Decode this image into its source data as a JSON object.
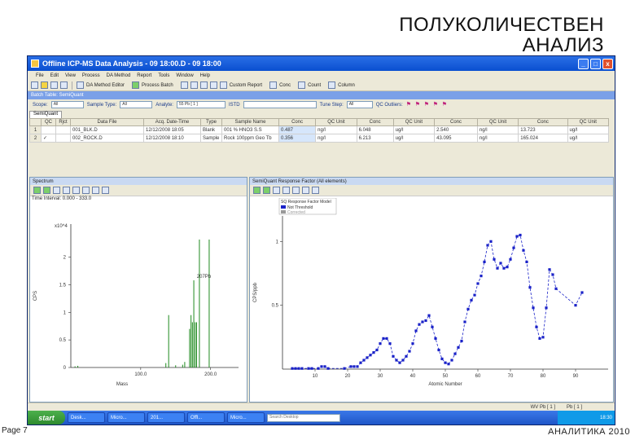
{
  "slide": {
    "title_line1": "ПОЛУКОЛИЧЕСТВЕН",
    "title_line2": "АНАЛИЗ",
    "page": "Page 7",
    "footer": "АНАЛИТИКА 2010"
  },
  "window": {
    "title": "Offline ICP-MS Data Analysis - 09 18:00.D - 09 18:00",
    "buttons": [
      "_",
      "□",
      "x"
    ]
  },
  "menu": [
    "File",
    "Edit",
    "View",
    "Process",
    "DA Method",
    "Report",
    "Tools",
    "Window",
    "Help"
  ],
  "toolbar": {
    "labels": [
      "DA Method Editor",
      "Process Batch",
      "Custom Report",
      "Conc",
      "Count",
      "Column"
    ]
  },
  "batch_title": "Batch Table: SemiQuant",
  "filters": {
    "scope_label": "Scope:",
    "scope_value": "All",
    "sample_type_label": "Sample Type:",
    "sample_type_value": "All",
    "analyte_label": "Analyte:",
    "analyte_value": "55 Pb [ 1 ]",
    "istd_label": "ISTD",
    "tune_step_label": "Tune Step:",
    "tune_step_value": "All",
    "qc_outliers_label": "QC Outliers:"
  },
  "tab": "SemiQuant",
  "table": {
    "headers": [
      "",
      "QC",
      "Rjct",
      "Data File",
      "Acq. Date-Time",
      "Type",
      "Sample Name",
      "Conc",
      "QC Unit",
      "Conc",
      "QC Unit",
      "Conc",
      "QC Unit",
      "Conc",
      "QC Unit"
    ],
    "rows": [
      [
        "1",
        "",
        "",
        "001_BLK.D",
        "12/12/2008 18:05",
        "Blank",
        "001 % HNO3 S.S",
        "0.487",
        "ng/l",
        "6.048",
        "ug/l",
        "2.540",
        "ng/l",
        "13.723",
        "ug/l"
      ],
      [
        "2",
        "✓",
        "",
        "002_ROCK.D",
        "12/12/2008 18:10",
        "Sample",
        "Rock 100ppm Geo Tb",
        "0.356",
        "ng/l",
        "6.213",
        "ug/l",
        "43.095",
        "ng/l",
        "165.024",
        "ug/l"
      ]
    ]
  },
  "left_pane": {
    "title": "Spectrum",
    "subtitle": "Time Interval: 0.000 - 333.0",
    "y_multiplier": "x10^4",
    "y_axis_label": "CPS",
    "x_axis_label": "Mass",
    "annotation": "207Pb"
  },
  "right_pane": {
    "title": "SemiQuant Response Factor (All elements)",
    "legend_title": "SQ Response Factor Model",
    "legend_items": [
      "Not Threshold",
      "Corrected"
    ],
    "y_axis_label": "CPS/ppb",
    "x_axis_label": "Atomic Number"
  },
  "status": {
    "left": "WV Pb [ 1 ]",
    "right": "Pb [ 1 ]"
  },
  "taskbar": {
    "start": "start",
    "tasks": [
      "Desk...",
      "Micro...",
      "201...",
      "Offl...",
      "Micro..."
    ],
    "search_placeholder": "Search Desktop",
    "clock": "18:30"
  },
  "chart_data": [
    {
      "type": "bar",
      "title": "",
      "x_label": "Mass",
      "y_label": "CPS",
      "y_multiplier": "x10^4",
      "x_range": [
        0,
        240
      ],
      "y_range": [
        0,
        2.6
      ],
      "x_ticks": [
        100,
        200
      ],
      "y_ticks": [
        0,
        0.5,
        1,
        1.5,
        2
      ],
      "bars": [
        {
          "x": 6,
          "y": 0.02
        },
        {
          "x": 10,
          "y": 0.03
        },
        {
          "x": 136,
          "y": 0.08
        },
        {
          "x": 140,
          "y": 0.95
        },
        {
          "x": 150,
          "y": 0.04
        },
        {
          "x": 160,
          "y": 0.05
        },
        {
          "x": 163,
          "y": 0.1
        },
        {
          "x": 170,
          "y": 0.7
        },
        {
          "x": 172,
          "y": 0.95
        },
        {
          "x": 174,
          "y": 0.82
        },
        {
          "x": 176,
          "y": 1.58
        },
        {
          "x": 178,
          "y": 0.82
        },
        {
          "x": 180,
          "y": 0.82
        },
        {
          "x": 184,
          "y": 2.32
        },
        {
          "x": 198,
          "y": 2.32
        }
      ]
    },
    {
      "type": "line",
      "title": "",
      "x_label": "Atomic Number",
      "y_label": "CPS/ppb",
      "x_range": [
        0,
        100
      ],
      "y_range": [
        0,
        1.2
      ],
      "x_ticks": [
        10,
        20,
        30,
        40,
        50,
        60,
        70,
        80,
        90
      ],
      "y_ticks": [
        0.5,
        1
      ],
      "series": [
        {
          "name": "Not Threshold",
          "points": [
            [
              3,
              0.005
            ],
            [
              4,
              0.005
            ],
            [
              5,
              0.005
            ],
            [
              6,
              0.005
            ],
            [
              8,
              0.005
            ],
            [
              9,
              0.005
            ],
            [
              11,
              0.005
            ],
            [
              12,
              0.02
            ],
            [
              13,
              0.02
            ],
            [
              14,
              0.005
            ],
            [
              19,
              0.005
            ],
            [
              21,
              0.02
            ],
            [
              22,
              0.02
            ],
            [
              23,
              0.02
            ],
            [
              24,
              0.05
            ],
            [
              25,
              0.07
            ],
            [
              26,
              0.09
            ],
            [
              27,
              0.11
            ],
            [
              28,
              0.13
            ],
            [
              29,
              0.15
            ],
            [
              30,
              0.2
            ],
            [
              31,
              0.24
            ],
            [
              32,
              0.24
            ],
            [
              33,
              0.2
            ],
            [
              34,
              0.1
            ],
            [
              35,
              0.07
            ],
            [
              36,
              0.05
            ],
            [
              37,
              0.07
            ],
            [
              38,
              0.1
            ],
            [
              39,
              0.14
            ],
            [
              40,
              0.2
            ],
            [
              41,
              0.3
            ],
            [
              42,
              0.35
            ],
            [
              43,
              0.37
            ],
            [
              44,
              0.38
            ],
            [
              45,
              0.42
            ],
            [
              46,
              0.33
            ],
            [
              47,
              0.24
            ],
            [
              48,
              0.15
            ],
            [
              49,
              0.08
            ],
            [
              50,
              0.05
            ],
            [
              51,
              0.04
            ],
            [
              52,
              0.07
            ],
            [
              53,
              0.12
            ],
            [
              54,
              0.17
            ],
            [
              55,
              0.22
            ],
            [
              56,
              0.37
            ],
            [
              57,
              0.47
            ],
            [
              58,
              0.54
            ],
            [
              59,
              0.58
            ],
            [
              60,
              0.67
            ],
            [
              61,
              0.73
            ],
            [
              62,
              0.84
            ],
            [
              63,
              0.97
            ],
            [
              64,
              1.0
            ],
            [
              65,
              0.86
            ],
            [
              66,
              0.79
            ],
            [
              67,
              0.83
            ],
            [
              68,
              0.79
            ],
            [
              69,
              0.8
            ],
            [
              70,
              0.86
            ],
            [
              71,
              0.95
            ],
            [
              72,
              1.04
            ],
            [
              73,
              1.05
            ],
            [
              74,
              0.93
            ],
            [
              75,
              0.84
            ],
            [
              76,
              0.64
            ],
            [
              77,
              0.48
            ],
            [
              78,
              0.33
            ],
            [
              79,
              0.24
            ],
            [
              80,
              0.25
            ],
            [
              81,
              0.48
            ],
            [
              82,
              0.78
            ],
            [
              83,
              0.74
            ],
            [
              84,
              0.63
            ],
            [
              90,
              0.5
            ],
            [
              92,
              0.6
            ]
          ]
        },
        {
          "name": "Corrected",
          "points": []
        }
      ]
    }
  ]
}
